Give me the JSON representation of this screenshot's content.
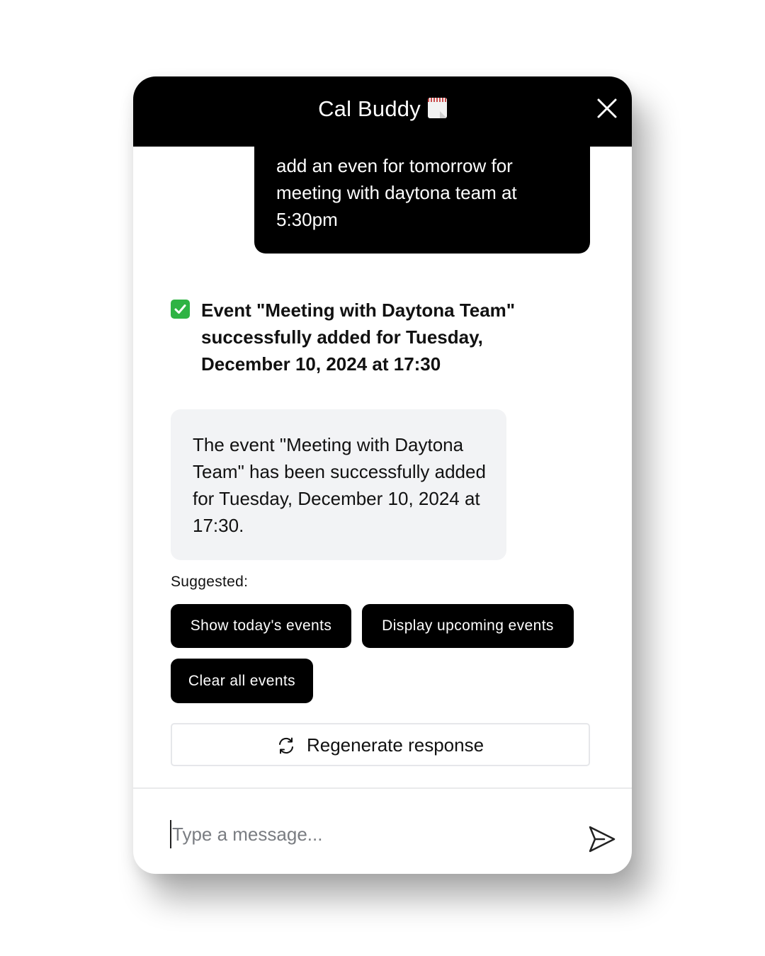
{
  "header": {
    "title": "Cal Buddy",
    "title_icon": "calendar-icon",
    "close_icon": "close-icon"
  },
  "conversation": {
    "user_message": "add an even for tomorrow for meeting with daytona team at 5:30pm",
    "status_icon": "check-mark-icon",
    "status_message": "Event \"Meeting with Daytona Team\" successfully added for Tuesday, December 10, 2024 at 17:30",
    "assistant_message": "The event \"Meeting with Daytona Team\" has been successfully added for Tuesday, December 10, 2024 at 17:30."
  },
  "suggestions": {
    "label": "Suggested:",
    "items": [
      "Show today's events",
      "Display upcoming events",
      "Clear all events"
    ]
  },
  "regenerate": {
    "label": "Regenerate response",
    "icon": "refresh-icon"
  },
  "composer": {
    "placeholder": "Type a message...",
    "value": "",
    "send_icon": "send-icon"
  },
  "colors": {
    "header_bg": "#000000",
    "user_bubble_bg": "#000000",
    "assistant_bubble_bg": "#f2f3f5",
    "chip_bg": "#000000",
    "check_green": "#2fb344"
  }
}
